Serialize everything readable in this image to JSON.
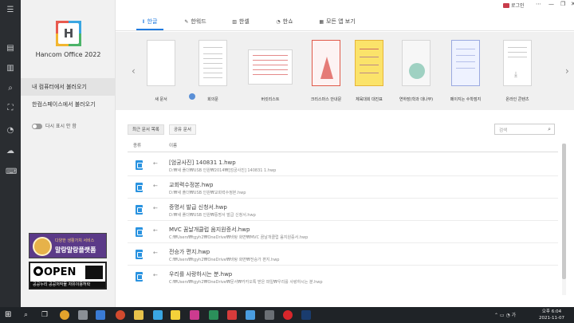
{
  "app": {
    "brand": "Hancom Office 2022",
    "logo_letter": "H"
  },
  "window": {
    "login_label": "로그인"
  },
  "sidebar": {
    "items": [
      {
        "label": "내 컴퓨터에서 불러오기"
      },
      {
        "label": "한컴스페이스에서 불러오기"
      }
    ],
    "toggle_label": "다시 표시 안 함"
  },
  "tabs": [
    {
      "label": "한글",
      "icon": "hwp-icon"
    },
    {
      "label": "한워드",
      "icon": "pen-icon"
    },
    {
      "label": "한셀",
      "icon": "chart-icon"
    },
    {
      "label": "한쇼",
      "icon": "pie-icon"
    },
    {
      "label": "모든 앱 보기",
      "icon": "grid-icon"
    }
  ],
  "templates": [
    {
      "label": "새 문서"
    },
    {
      "label": "회의문"
    },
    {
      "label": "버킷리스트"
    },
    {
      "label": "크리스마스 안내문"
    },
    {
      "label": "체육대회 대진표"
    },
    {
      "label": "연하장(학과 대나무)"
    },
    {
      "label": "페이지는 수학점지"
    },
    {
      "label": "온라인 콘텐츠"
    }
  ],
  "recent": {
    "tabs": [
      "최근 문서 목록",
      "공유 문서"
    ],
    "search_placeholder": "검색",
    "columns": [
      "종류",
      "이름"
    ],
    "files": [
      {
        "name": "[엄궁사진] 140831 1.hwp",
        "path": "D:₩새 폴더₩USB 인원₩2014₩[엄궁사진] 140831 1.hwp"
      },
      {
        "name": "교회력수정본.hwp",
        "path": "D:₩새 폴더₩USB 인원₩교회력수정본.hwp"
      },
      {
        "name": "증명서 발급 신청서.hwp",
        "path": "D:₩새 폴더₩USB 인원₩증명서 발급 신청서.hwp"
      },
      {
        "name": "MVC 꿈날개클럽 움지원증서.hwp",
        "path": "C:₩Users₩tgyh2₩OneDrive₩바탕 화면₩MVC 꿈날개클럽 움지원증서.hwp"
      },
      {
        "name": "전승가 편지.hwp",
        "path": "C:₩Users₩tgyh2₩OneDrive₩바탕 화면₩전승가 편지.hwp"
      },
      {
        "name": "우리를 사랑하시는 분.hwp",
        "path": "C:₩Users₩tgyh2₩OneDrive₩문서₩카카오톡 받은 파일₩우리를 사랑하시는 분.hwp"
      }
    ]
  },
  "ads": {
    "top_line": "다양한 생활가치 서비스",
    "banner_title": "말랑말랑플랫폼",
    "open_text": "OPEN",
    "open_bar": "공공누리  공공저작물 자유이용허락"
  },
  "taskbar": {
    "time": "오후 6:04",
    "date": "2021-11-07"
  }
}
